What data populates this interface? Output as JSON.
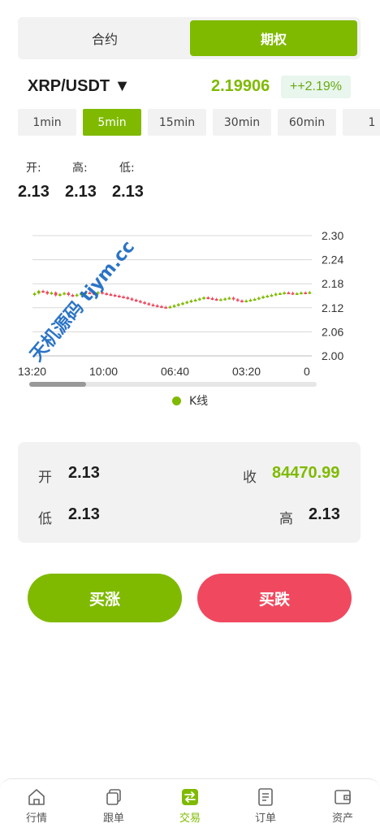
{
  "segment": {
    "left": "合约",
    "right": "期权"
  },
  "symbol": {
    "pair": "XRP/USDT ▼",
    "price": "2.19906",
    "change": "++2.19%"
  },
  "intervals": [
    "1min",
    "5min",
    "15min",
    "30min",
    "60min",
    "1"
  ],
  "active_interval": "5min",
  "ohl": {
    "open_label": "开:",
    "high_label": "高:",
    "low_label": "低:",
    "open": "2.13",
    "high": "2.13",
    "low": "2.13"
  },
  "colors": {
    "accent": "#7fba00",
    "down": "#f0495f"
  },
  "chart_data": {
    "type": "candlestick",
    "y_ticks": [
      "2.30",
      "2.24",
      "2.18",
      "2.12",
      "2.06",
      "2.00"
    ],
    "ylim": [
      2.0,
      2.3
    ],
    "x_ticks": [
      "13:20",
      "10:00",
      "06:40",
      "03:20",
      "0"
    ],
    "legend": [
      "K线"
    ],
    "legend_position": "bottom",
    "grid": true,
    "closes": [
      2.156,
      2.162,
      2.16,
      2.155,
      2.158,
      2.151,
      2.154,
      2.157,
      2.152,
      2.15,
      2.153,
      2.156,
      2.158,
      2.157,
      2.155,
      2.159,
      2.156,
      2.154,
      2.152,
      2.15,
      2.148,
      2.146,
      2.143,
      2.14,
      2.137,
      2.134,
      2.131,
      2.128,
      2.126,
      2.124,
      2.122,
      2.121,
      2.123,
      2.126,
      2.129,
      2.132,
      2.135,
      2.138,
      2.14,
      2.143,
      2.146,
      2.144,
      2.142,
      2.14,
      2.141,
      2.143,
      2.145,
      2.141,
      2.138,
      2.136,
      2.138,
      2.14,
      2.142,
      2.145,
      2.148,
      2.15,
      2.152,
      2.155,
      2.156,
      2.158,
      2.157,
      2.155,
      2.156,
      2.158,
      2.157,
      2.159
    ]
  },
  "summary": {
    "open_label": "开",
    "open": "2.13",
    "close_label": "收",
    "close": "84470.99",
    "low_label": "低",
    "low": "2.13",
    "high_label": "高",
    "high": "2.13"
  },
  "actions": {
    "buy": "买涨",
    "sell": "买跌"
  },
  "watermark": "天机源码 tjym.cc",
  "tabs": [
    {
      "label": "行情",
      "icon": "home-icon"
    },
    {
      "label": "跟单",
      "icon": "copy-icon"
    },
    {
      "label": "交易",
      "icon": "exchange-icon"
    },
    {
      "label": "订单",
      "icon": "orders-icon"
    },
    {
      "label": "资产",
      "icon": "wallet-icon"
    }
  ],
  "active_tab": "交易"
}
